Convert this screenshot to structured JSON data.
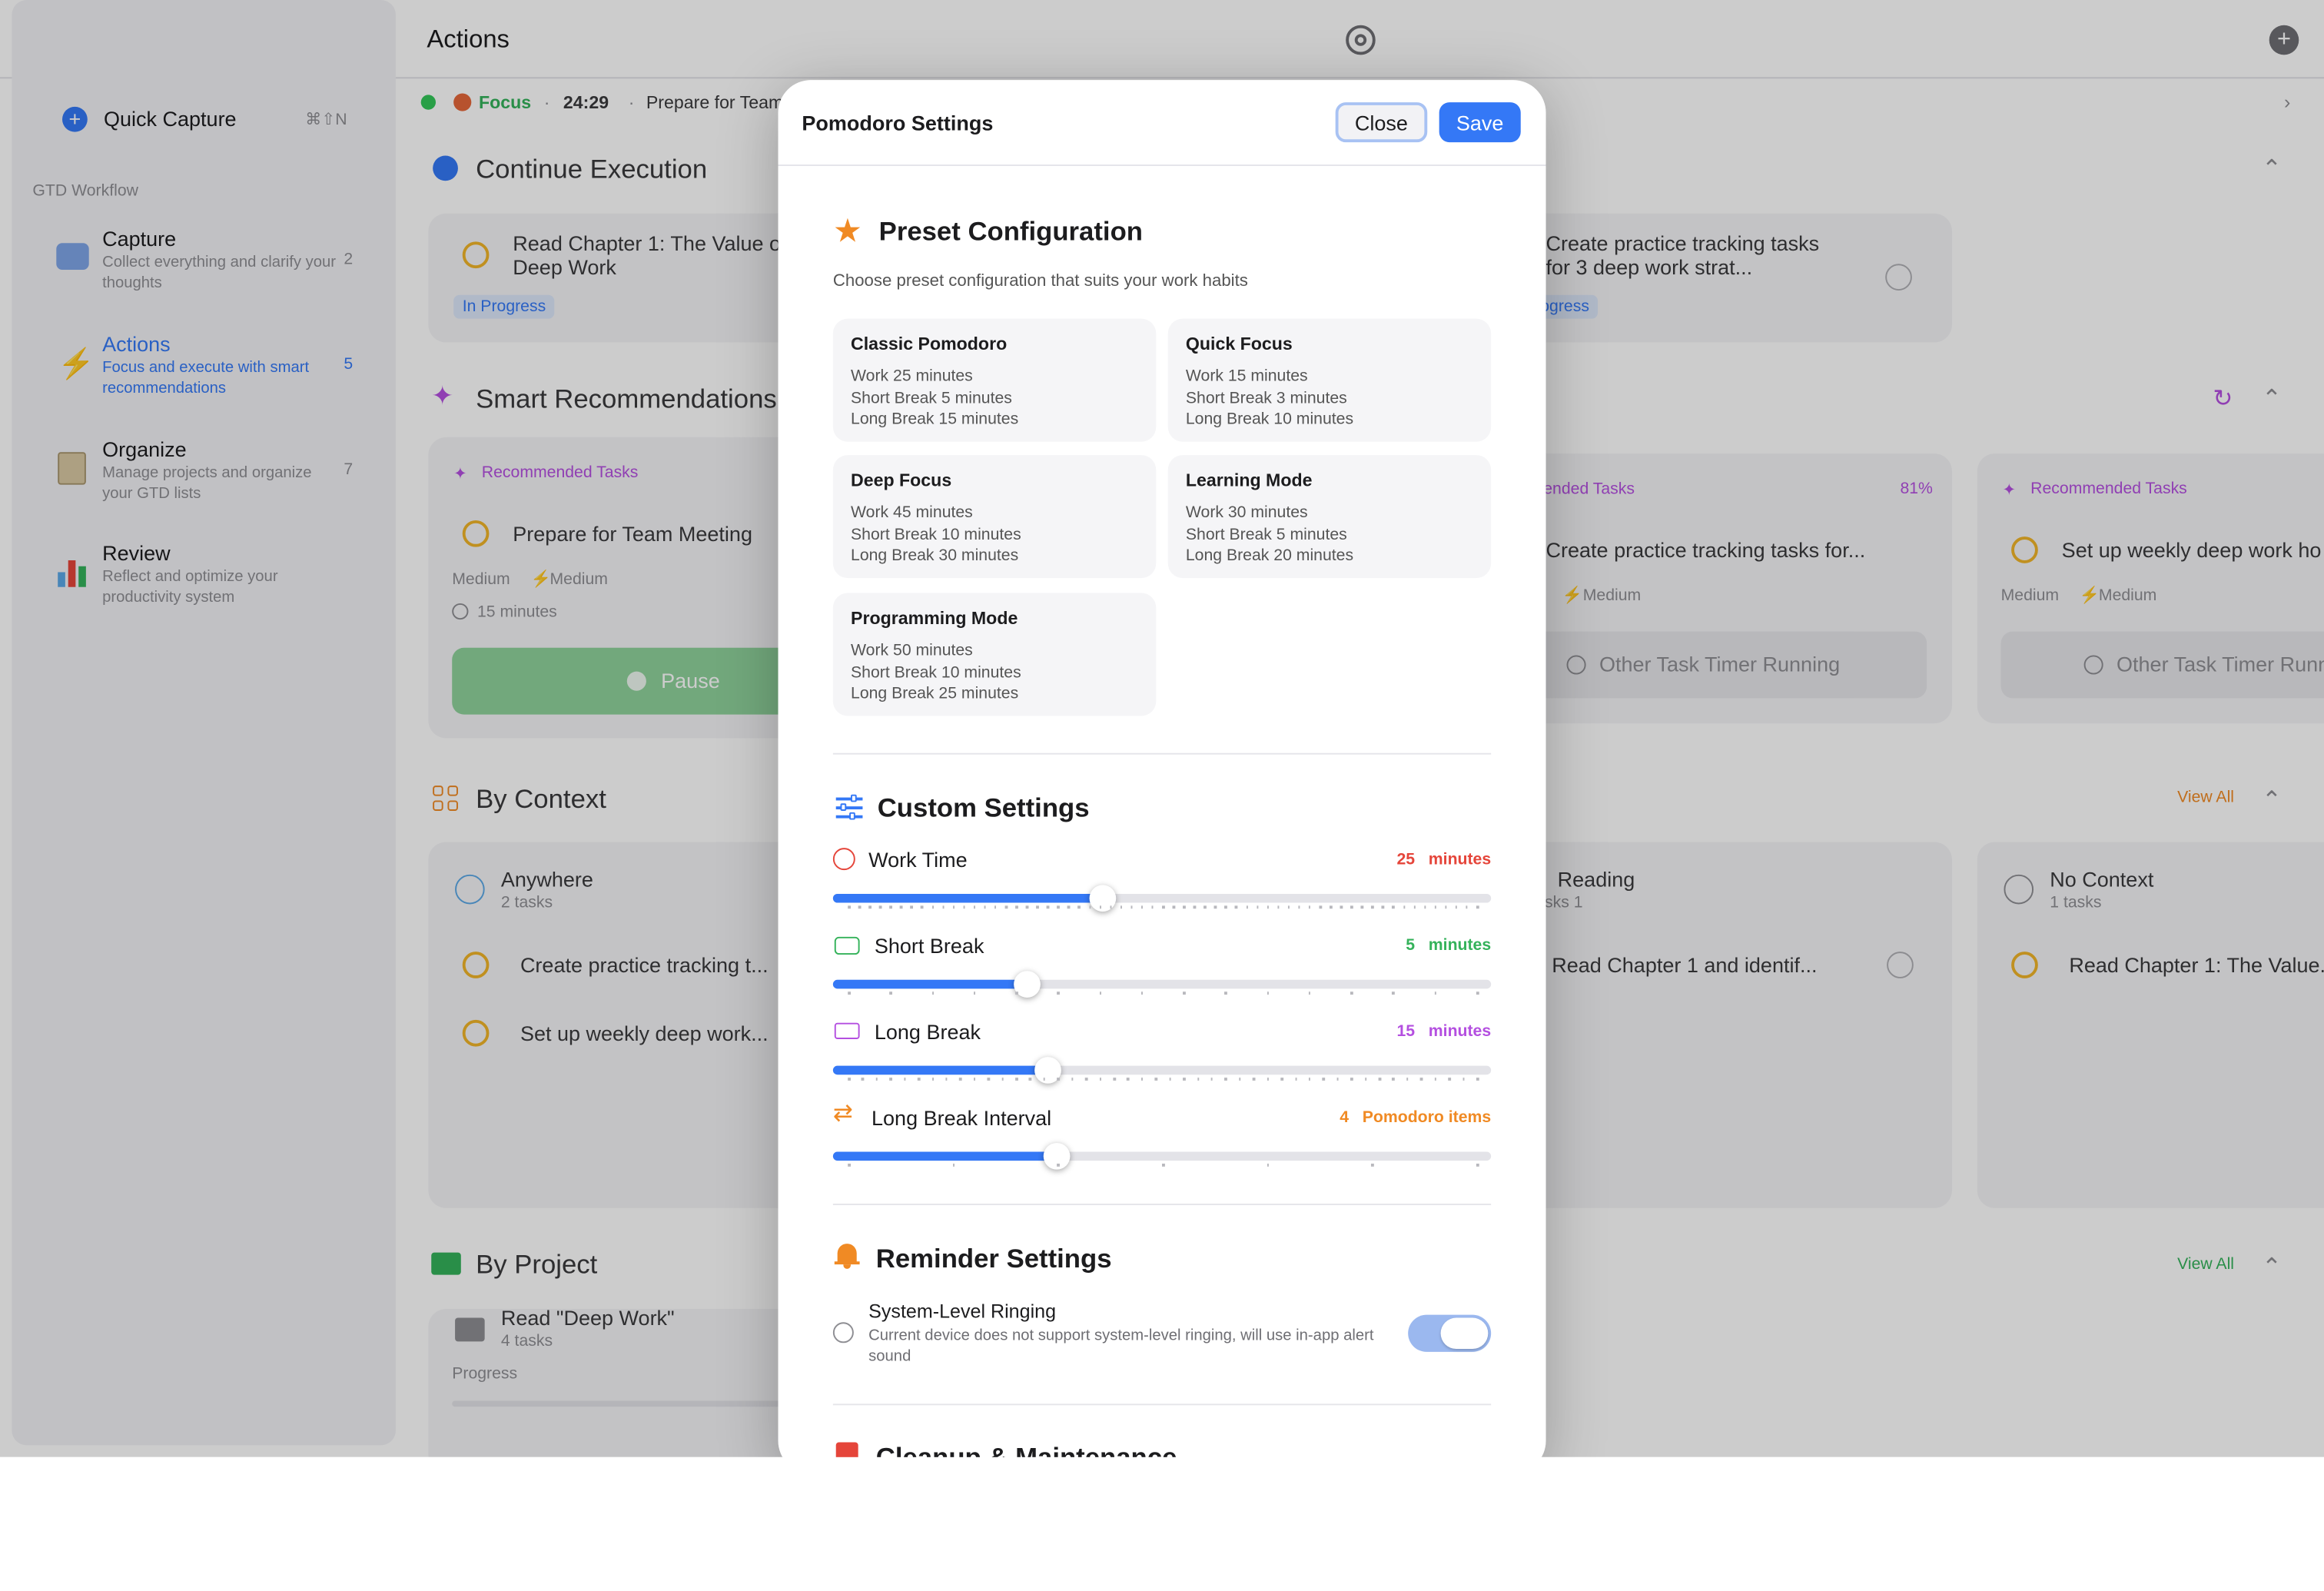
{
  "colors": {
    "accent": "#3478f6",
    "work": "#e5453a",
    "short": "#34b25a",
    "long": "#b44fe0",
    "interval": "#f08a24"
  },
  "topbar": {
    "title": "Actions"
  },
  "sidebar": {
    "quick_capture": "Quick Capture",
    "shortcut": "⌘⇧N",
    "section_title": "GTD Workflow",
    "items": [
      {
        "title": "Capture",
        "desc": "Collect everything and clarify your thoughts",
        "count": "2",
        "icon": "inbox-tray-icon"
      },
      {
        "title": "Actions",
        "desc": "Focus and execute with smart recommendations",
        "count": "5",
        "icon": "lightning-icon"
      },
      {
        "title": "Organize",
        "desc": "Manage projects and organize your GTD lists",
        "count": "7",
        "icon": "clipboard-icon"
      },
      {
        "title": "Review",
        "desc": "Reflect and optimize your productivity system",
        "count": "",
        "icon": "bar-chart-icon"
      }
    ]
  },
  "focus_bar": {
    "mode": "Focus",
    "time": "24:29",
    "task": "Prepare for Team"
  },
  "main": {
    "continue_title": "Continue Execution",
    "continue_task_1": "Read Chapter 1: The Value of Deep Work",
    "continue_badge_1": "In Progress",
    "continue_task_2": "Create practice tracking tasks for 3 deep work strat...",
    "continue_badge_2": "In Progress",
    "smart_title": "Smart Recommendations",
    "rec_label": "Recommended Tasks",
    "rec_task_1": "Prepare for Team Meeting",
    "rec_meta_priority": "Medium",
    "rec_meta_energy": "Medium",
    "rec_time": "15 minutes",
    "pause_label": "Pause",
    "rec_task_2": "Create practice tracking tasks for...",
    "rec_percent_2": "81%",
    "other_timer": "Other Task Timer Running",
    "rec_task_3": "Set up weekly deep work ho",
    "context_title": "By Context",
    "view_all": "View All",
    "ctx_1_name": "Anywhere",
    "ctx_1_count": "2 tasks",
    "ctx_1_task_1": "Create practice tracking t...",
    "ctx_1_task_2": "Set up weekly deep work...",
    "ctx_2_name": "Reading",
    "ctx_2_count": "1 tasks",
    "ctx_2_task_1": "Read Chapter 1 and identif...",
    "ctx_3_name": "No Context",
    "ctx_3_count": "1 tasks",
    "ctx_3_task_1": "Read Chapter 1: The Value...",
    "project_title": "By Project",
    "proj_1_name": "Read \"Deep Work\"",
    "proj_1_count": "4 tasks",
    "proj_progress": "Progress"
  },
  "modal": {
    "title": "Pomodoro Settings",
    "close_label": "Close",
    "save_label": "Save",
    "preset_title": "Preset Configuration",
    "preset_subtitle": "Choose preset configuration that suits your work habits",
    "presets": [
      {
        "name": "Classic Pomodoro",
        "work": "Work 25 minutes",
        "short": "Short Break 5 minutes",
        "long": "Long Break 15 minutes"
      },
      {
        "name": "Quick Focus",
        "work": "Work 15 minutes",
        "short": "Short Break 3 minutes",
        "long": "Long Break 10 minutes"
      },
      {
        "name": "Deep Focus",
        "work": "Work 45 minutes",
        "short": "Short Break 10 minutes",
        "long": "Long Break 30 minutes"
      },
      {
        "name": "Learning Mode",
        "work": "Work 30 minutes",
        "short": "Short Break 5 minutes",
        "long": "Long Break 20 minutes"
      },
      {
        "name": "Programming Mode",
        "work": "Work 50 minutes",
        "short": "Short Break 10 minutes",
        "long": "Long Break 25 minutes"
      }
    ],
    "custom_title": "Custom Settings",
    "sliders": [
      {
        "label": "Work Time",
        "value": "25",
        "unit": "minutes",
        "fraction": 0.41,
        "color_key": "work"
      },
      {
        "label": "Short Break",
        "value": "5",
        "unit": "minutes",
        "fraction": 0.295,
        "color_key": "short"
      },
      {
        "label": "Long Break",
        "value": "15",
        "unit": "minutes",
        "fraction": 0.327,
        "color_key": "long"
      },
      {
        "label": "Long Break Interval",
        "value": "4",
        "unit": "Pomodoro items",
        "fraction": 0.339,
        "color_key": "interval"
      }
    ],
    "reminder_title": "Reminder Settings",
    "ringing_title": "System-Level Ringing",
    "ringing_desc": "Current device does not support system-level ringing, will use in-app alert sound",
    "ringing_on": true,
    "cleanup_title": "Cleanup & Maintenance"
  }
}
